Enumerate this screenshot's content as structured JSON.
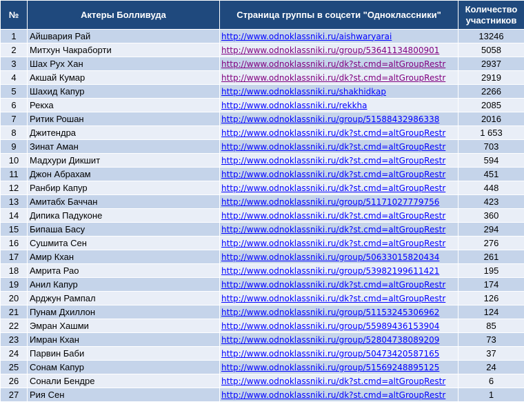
{
  "headers": {
    "num": "№",
    "actors": "Актеры Болливуда",
    "page": "Страница группы в соцсети \"Одноклассники\"",
    "count": "Количество участников"
  },
  "colors": {
    "header_bg": "#1f497d",
    "row_dark": "#c5d4ea",
    "row_light": "#e9eef7",
    "link": "#0000ff",
    "visited_link": "#800080"
  },
  "rows": [
    {
      "num": "1",
      "name": "Айшвария Рай",
      "url": "http://www.odnoklassniki.ru/aishwaryarai",
      "count": "13246",
      "visited": false
    },
    {
      "num": "2",
      "name": "Митхун Чакраборти",
      "url": "http://www.odnoklassniki.ru/group/53641134800901",
      "count": "5058",
      "visited": true
    },
    {
      "num": "3",
      "name": "Шах Рух Хан",
      "url": "http://www.odnoklassniki.ru/dk?st.cmd=altGroupRestr",
      "count": "2937",
      "visited": true
    },
    {
      "num": "4",
      "name": "Акшай Кумар",
      "url": "http://www.odnoklassniki.ru/dk?st.cmd=altGroupRestr",
      "count": "2919",
      "visited": true
    },
    {
      "num": "5",
      "name": "Шахид Капур",
      "url": "http://www.odnoklassniki.ru/shakhidkap",
      "count": "2266",
      "visited": false
    },
    {
      "num": "6",
      "name": "Рекха",
      "url": "http://www.odnoklassniki.ru/rekkha",
      "count": "2085",
      "visited": false
    },
    {
      "num": "7",
      "name": "Ритик Рошан",
      "url": "http://www.odnoklassniki.ru/group/51588432986338",
      "count": "2016",
      "visited": false
    },
    {
      "num": "8",
      "name": "Джитендра",
      "url": "http://www.odnoklassniki.ru/dk?st.cmd=altGroupRestr",
      "count": "1 653",
      "visited": false
    },
    {
      "num": "9",
      "name": "Зинат Аман",
      "url": "http://www.odnoklassniki.ru/dk?st.cmd=altGroupRestr",
      "count": "703",
      "visited": false
    },
    {
      "num": "10",
      "name": "Мадхури Дикшит",
      "url": "http://www.odnoklassniki.ru/dk?st.cmd=altGroupRestr",
      "count": "594",
      "visited": false
    },
    {
      "num": "11",
      "name": "Джон Абрахам",
      "url": "http://www.odnoklassniki.ru/dk?st.cmd=altGroupRestr",
      "count": "451",
      "visited": false
    },
    {
      "num": "12",
      "name": "Ранбир Капур",
      "url": "http://www.odnoklassniki.ru/dk?st.cmd=altGroupRestr",
      "count": "448",
      "visited": false
    },
    {
      "num": "13",
      "name": "Амитабх Баччан",
      "url": "http://www.odnoklassniki.ru/group/51171027779756",
      "count": "423",
      "visited": false
    },
    {
      "num": "14",
      "name": "Дипика Падуконе",
      "url": "http://www.odnoklassniki.ru/dk?st.cmd=altGroupRestr",
      "count": "360",
      "visited": false
    },
    {
      "num": "15",
      "name": "Бипаша Басу",
      "url": "http://www.odnoklassniki.ru/dk?st.cmd=altGroupRestr",
      "count": "294",
      "visited": false
    },
    {
      "num": "16",
      "name": "Сушмита Сен",
      "url": "http://www.odnoklassniki.ru/dk?st.cmd=altGroupRestr",
      "count": "276",
      "visited": false
    },
    {
      "num": "17",
      "name": "Амир Кхан",
      "url": "http://www.odnoklassniki.ru/group/50633015820434",
      "count": "261",
      "visited": false
    },
    {
      "num": "18",
      "name": "Амрита Рао",
      "url": "http://www.odnoklassniki.ru/group/53982199611421",
      "count": "195",
      "visited": false
    },
    {
      "num": "19",
      "name": "Анил Капур",
      "url": "http://www.odnoklassniki.ru/dk?st.cmd=altGroupRestr",
      "count": "174",
      "visited": false
    },
    {
      "num": "20",
      "name": "Арджун Рампал",
      "url": "http://www.odnoklassniki.ru/dk?st.cmd=altGroupRestr",
      "count": "126",
      "visited": false
    },
    {
      "num": "21",
      "name": "Пунам Дхиллон",
      "url": "http://www.odnoklassniki.ru/group/51153245306962",
      "count": "124",
      "visited": false
    },
    {
      "num": "22",
      "name": "Эмран Хашми",
      "url": "http://www.odnoklassniki.ru/group/55989436153904",
      "count": "85",
      "visited": false
    },
    {
      "num": "23",
      "name": "Имран Кхан",
      "url": "http://www.odnoklassniki.ru/group/52804738089209",
      "count": "73",
      "visited": false
    },
    {
      "num": "24",
      "name": "Парвин Баби",
      "url": "http://www.odnoklassniki.ru/group/50473420587165",
      "count": "37",
      "visited": false
    },
    {
      "num": "25",
      "name": "Сонам Капур",
      "url": "http://www.odnoklassniki.ru/group/51569248895125",
      "count": "24",
      "visited": false
    },
    {
      "num": "26",
      "name": "Сонали Бендре",
      "url": "http://www.odnoklassniki.ru/dk?st.cmd=altGroupRestr",
      "count": "6",
      "visited": false
    },
    {
      "num": "27",
      "name": "Рия Сен",
      "url": "http://www.odnoklassniki.ru/dk?st.cmd=altGroupRestr",
      "count": "1",
      "visited": false
    }
  ]
}
